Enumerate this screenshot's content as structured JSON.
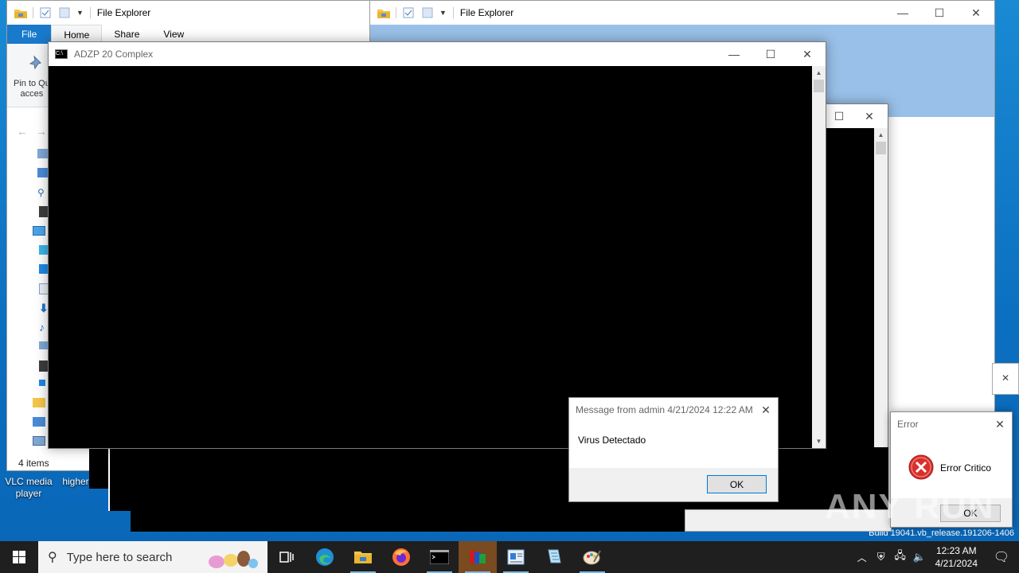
{
  "explorer_left": {
    "title": "File Explorer",
    "ribbon_tabs": [
      "File",
      "Home",
      "Share",
      "View"
    ],
    "pin_label_line1": "Pin to Qu",
    "pin_label_line2": "acces",
    "status_items": "4 items"
  },
  "explorer_right": {
    "title": "File Explorer"
  },
  "console_main": {
    "title": "ADZP 20 Complex"
  },
  "message_dialog": {
    "title": "Message from admin 4/21/2024 12:22 AM",
    "message": "Virus Detectado",
    "ok_label": "OK"
  },
  "error_dialog": {
    "title": "Error",
    "message": "Error Critico",
    "ok_label": "OK"
  },
  "desktop": {
    "icons": [
      {
        "label_line1": "VLC media",
        "label_line2": "player"
      },
      {
        "label_line1": "higher",
        "label_line2": ""
      }
    ],
    "build_text": "Build 19041.vb_release.191206-1406"
  },
  "taskbar": {
    "search_placeholder": "Type here to search",
    "clock_time": "12:23 AM",
    "clock_date": "4/21/2024",
    "apps": [
      "task-view",
      "edge",
      "file-explorer",
      "firefox",
      "cmd",
      "winrar",
      "wordpad",
      "notepad-plus",
      "paint"
    ]
  },
  "watermark": "ANY RUN",
  "colors": {
    "accent": "#1979ca",
    "desktop": "#0b6fc0",
    "taskbar": "#1f1f1f",
    "error_red": "#d9302c"
  }
}
